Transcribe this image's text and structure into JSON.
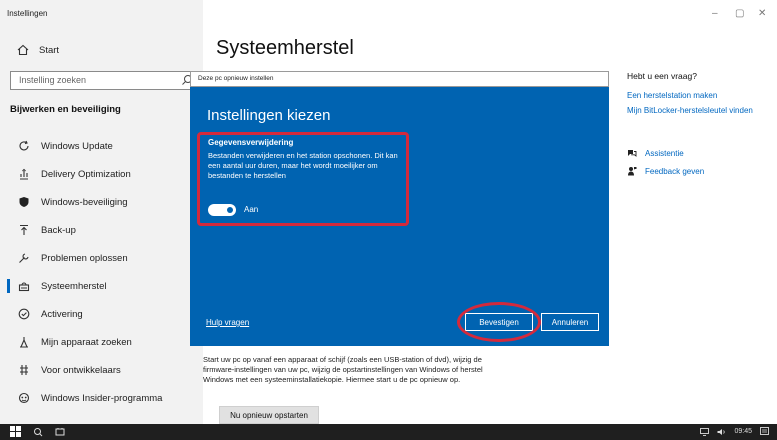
{
  "window": {
    "title": "Instellingen",
    "minimize": "–",
    "maximize": "▢",
    "close": "✕"
  },
  "sidebar": {
    "home_label": "Start",
    "search_placeholder": "Instelling zoeken",
    "section_title": "Bijwerken en beveiliging",
    "items": [
      {
        "label": "Windows Update",
        "icon": "refresh-icon"
      },
      {
        "label": "Delivery Optimization",
        "icon": "delivery-optimization-icon"
      },
      {
        "label": "Windows-beveiliging",
        "icon": "shield-icon"
      },
      {
        "label": "Back-up",
        "icon": "backup-arrow-icon"
      },
      {
        "label": "Problemen oplossen",
        "icon": "wrench-icon"
      },
      {
        "label": "Systeemherstel",
        "icon": "system-restore-icon",
        "active": true
      },
      {
        "label": "Activering",
        "icon": "activation-check-icon"
      },
      {
        "label": "Mijn apparaat zoeken",
        "icon": "find-device-icon"
      },
      {
        "label": "Voor ontwikkelaars",
        "icon": "developer-icon"
      },
      {
        "label": "Windows Insider-programma",
        "icon": "insider-icon"
      }
    ]
  },
  "main": {
    "page_title": "Systeemherstel",
    "dialog": {
      "header": "Deze pc opnieuw instellen",
      "title": "Instellingen kiezen",
      "subhead": "Gegevensverwijdering",
      "description": "Bestanden verwijderen en het station opschonen. Dit kan een aantal uur duren, maar het wordt moeilijker om bestanden te herstellen",
      "toggle_label": "Aan",
      "toggle_on": true,
      "help_link": "Hulp vragen",
      "confirm": "Bevestigen",
      "cancel": "Annuleren"
    },
    "below_text": "Start uw pc op vanaf een apparaat of schijf (zoals een USB-station of dvd), wijzig de firmware-instellingen van uw pc, wijzig de opstartinstellingen van Windows of herstel Windows met een systeeminstallatiekopie. Hiermee start u de pc opnieuw op.",
    "restart_button": "Nu opnieuw opstarten"
  },
  "right_panel": {
    "title": "Hebt u een vraag?",
    "links": [
      "Een herstelstation maken",
      "Mijn BitLocker-herstelsleutel vinden"
    ],
    "help_items": [
      {
        "label": "Assistentie",
        "icon": "assistance-icon"
      },
      {
        "label": "Feedback geven",
        "icon": "feedback-icon"
      }
    ]
  },
  "taskbar": {
    "clock": "09:45"
  },
  "colors": {
    "accent": "#0063b1",
    "link": "#0067c0",
    "highlight": "#d42a3c"
  }
}
